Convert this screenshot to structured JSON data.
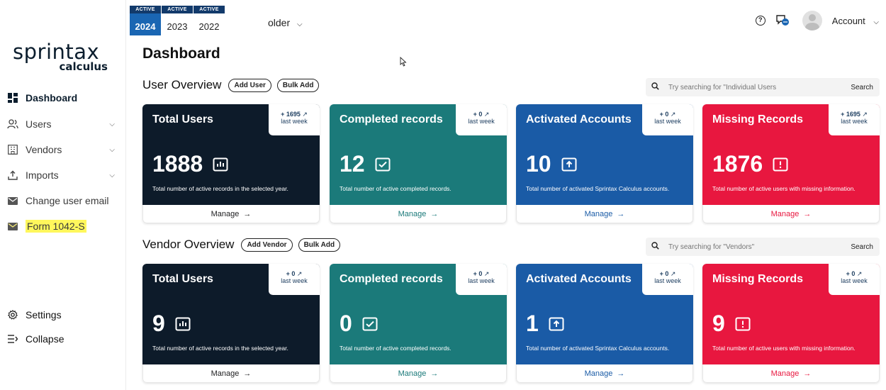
{
  "logo": {
    "main": "sprintax",
    "sub": "calculus"
  },
  "sidebar": {
    "items": [
      {
        "label": "Dashboard"
      },
      {
        "label": "Users"
      },
      {
        "label": "Vendors"
      },
      {
        "label": "Imports"
      },
      {
        "label": "Change user email"
      },
      {
        "label": "Form 1042-S"
      }
    ],
    "settings": "Settings",
    "collapse": "Collapse"
  },
  "year_tabs": [
    {
      "badge": "ACTIVE",
      "year": "2024"
    },
    {
      "badge": "ACTIVE",
      "year": "2023"
    },
    {
      "badge": "ACTIVE",
      "year": "2022"
    }
  ],
  "older": "older",
  "header": {
    "account": "Account"
  },
  "page_title": "Dashboard",
  "user_overview": {
    "title": "User Overview",
    "add_btn": "Add User",
    "bulk_btn": "Bulk Add",
    "search_placeholder": "Try searching for \"Individual Users",
    "search_btn": "Search",
    "cards": [
      {
        "title": "Total Users",
        "delta": "+ 1695",
        "delta_label": "last week",
        "value": "1888",
        "desc": "Total number of active records in the selected year.",
        "manage": "Manage"
      },
      {
        "title": "Completed records",
        "delta": "+ 0",
        "delta_label": "last week",
        "value": "12",
        "desc": "Total number of active completed records.",
        "manage": "Manage"
      },
      {
        "title": "Activated Accounts",
        "delta": "+ 0",
        "delta_label": "last week",
        "value": "10",
        "desc": "Total number of activated Sprintax Calculus accounts.",
        "manage": "Manage"
      },
      {
        "title": "Missing Records",
        "delta": "+ 1695",
        "delta_label": "last week",
        "value": "1876",
        "desc": "Total number of active users with missing information.",
        "manage": "Manage"
      }
    ]
  },
  "vendor_overview": {
    "title": "Vendor Overview",
    "add_btn": "Add Vendor",
    "bulk_btn": "Bulk Add",
    "search_placeholder": "Try searching for \"Vendors\"",
    "search_btn": "Search",
    "cards": [
      {
        "title": "Total Users",
        "delta": "+ 0",
        "delta_label": "last week",
        "value": "9",
        "desc": "Total number of active records in the selected year.",
        "manage": "Manage"
      },
      {
        "title": "Completed records",
        "delta": "+ 0",
        "delta_label": "last week",
        "value": "0",
        "desc": "Total number of active completed records.",
        "manage": "Manage"
      },
      {
        "title": "Activated Accounts",
        "delta": "+ 0",
        "delta_label": "last week",
        "value": "1",
        "desc": "Total number of activated Sprintax Calculus accounts.",
        "manage": "Manage"
      },
      {
        "title": "Missing Records",
        "delta": "+ 0",
        "delta_label": "last week",
        "value": "9",
        "desc": "Total number of active users with missing information.",
        "manage": "Manage"
      }
    ]
  },
  "colors": {
    "total": "#0d1b2a",
    "completed": "#1b7a7a",
    "activated": "#1a5ba6",
    "missing": "#e8173f",
    "highlight": "#fff75c"
  }
}
